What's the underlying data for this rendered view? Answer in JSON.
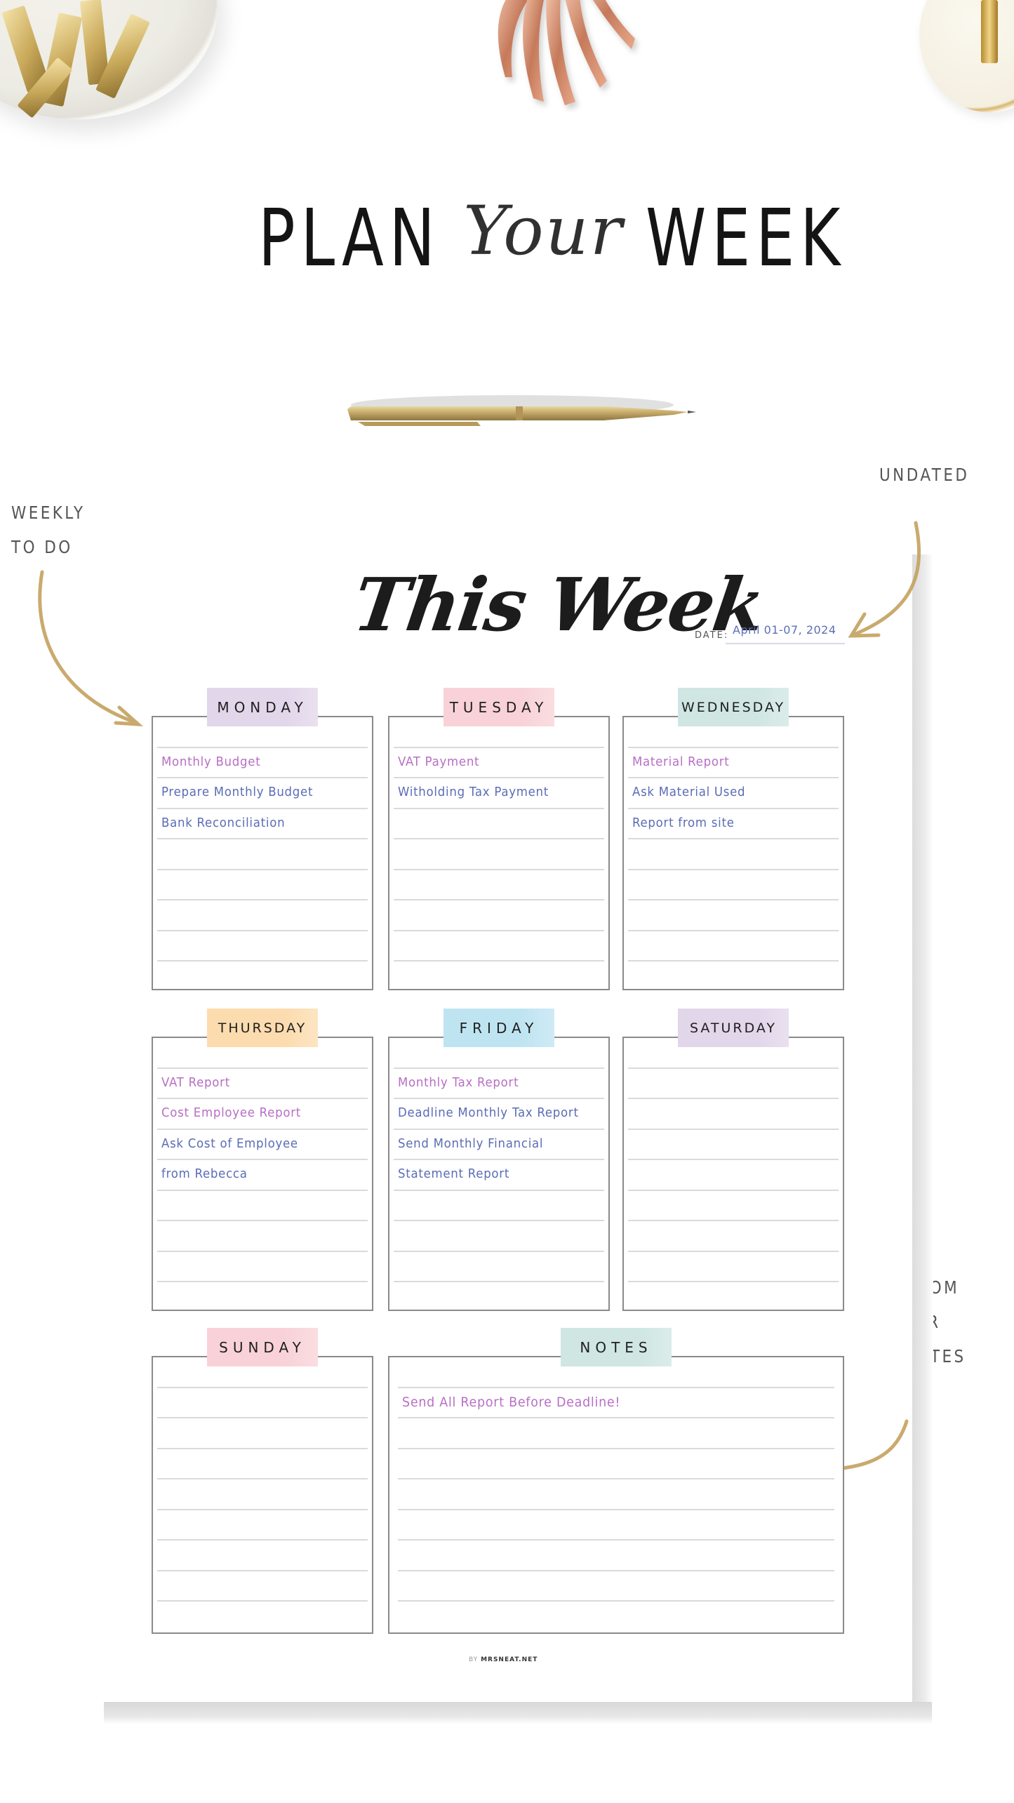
{
  "headline": {
    "word1": "PLAN",
    "word2": "Your",
    "word3": "WEEK"
  },
  "annotations": {
    "weekly_todo": [
      "WEEKLY",
      "TO DO"
    ],
    "undated": "UNDATED",
    "room_for_notes": [
      "ROOM",
      "FOR",
      "NOTES"
    ]
  },
  "planner": {
    "title": "This Week",
    "date_label": "DATE:",
    "date_value": "April 01-07, 2024",
    "colors": {
      "lavender": "#e2d6ea",
      "pink": "#f8d2d8",
      "mint": "#cfe6e3",
      "peach": "#fcdcae",
      "sky": "#bfe4f1",
      "entry_pink": "#b76fc5",
      "entry_blue": "#5a6db5"
    },
    "days": [
      {
        "name": "MONDAY",
        "tab_color": "#e2d6ea",
        "entries": [
          {
            "text": "Monthly Budget",
            "tone": "pink"
          },
          {
            "text": "Prepare Monthly Budget",
            "tone": "blue"
          },
          {
            "text": "Bank Reconciliation",
            "tone": "blue"
          }
        ]
      },
      {
        "name": "TUESDAY",
        "tab_color": "#f8d2d8",
        "entries": [
          {
            "text": "VAT Payment",
            "tone": "pink"
          },
          {
            "text": "Witholding Tax Payment",
            "tone": "blue"
          }
        ]
      },
      {
        "name": "WEDNESDAY",
        "tab_color": "#cfe6e3",
        "entries": [
          {
            "text": "Material Report",
            "tone": "pink"
          },
          {
            "text": "Ask Material Used",
            "tone": "blue"
          },
          {
            "text": "Report from site",
            "tone": "blue"
          }
        ]
      },
      {
        "name": "THURSDAY",
        "tab_color": "#fcdcae",
        "entries": [
          {
            "text": "VAT Report",
            "tone": "pink"
          },
          {
            "text": "Cost Employee Report",
            "tone": "pink"
          },
          {
            "text": "Ask Cost of Employee",
            "tone": "blue"
          },
          {
            "text": "from Rebecca",
            "tone": "blue"
          }
        ]
      },
      {
        "name": "FRIDAY",
        "tab_color": "#bfe4f1",
        "entries": [
          {
            "text": "Monthly Tax Report",
            "tone": "pink"
          },
          {
            "text": "Deadline Monthly Tax Report",
            "tone": "blue"
          },
          {
            "text": "Send Monthly Financial",
            "tone": "blue"
          },
          {
            "text": "Statement Report",
            "tone": "blue"
          }
        ]
      },
      {
        "name": "SATURDAY",
        "tab_color": "#e2d6ea",
        "entries": []
      },
      {
        "name": "SUNDAY",
        "tab_color": "#f8d2d8",
        "entries": []
      }
    ],
    "notes": {
      "name": "NOTES",
      "tab_color": "#cfe6e3",
      "entries": [
        {
          "text": "Send All Report Before Deadline!",
          "tone": "pink"
        }
      ]
    },
    "footer_by": "BY",
    "footer_brand": "MRSNEAT.NET"
  }
}
